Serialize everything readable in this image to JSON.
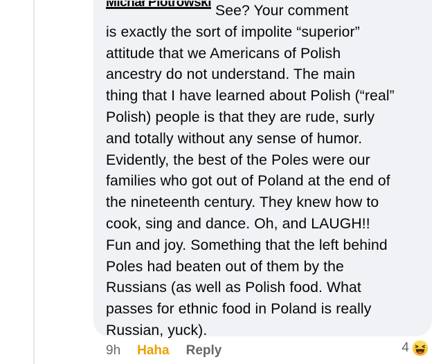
{
  "comment": {
    "author": "Michał Piotrowski",
    "lines": [
      "See?  Your comment",
      "is exactly the sort of impolite “superior”",
      "attitude that we Americans of Polish",
      "ancestry do not understand.  The main",
      "thing that I have learned about Polish (“real”",
      "Polish) people is that they are rude, surly",
      "and totally without any sense of humor.",
      "Evidently,  the best of the Poles were our",
      "families who got out of Poland at the end of",
      "the nineteenth century.  They knew how to",
      "cook, sing and dance.  Oh, and LAUGH!!",
      "Fun and joy.  Something that the left behind",
      "Poles had beaten out of them by the",
      "Russians (as well as Polish food.  What",
      "passes for ethnic food in Poland is really",
      "Russian, yuck)."
    ]
  },
  "actions": {
    "time": "9h",
    "reaction_label": "Haha",
    "reply_label": "Reply"
  },
  "reactions": {
    "count": "4",
    "icon": "haha-emoji-icon"
  },
  "colors": {
    "bubble": "#f0f2f5",
    "text": "#050505",
    "meta": "#65676b",
    "haha": "#e9a100"
  }
}
